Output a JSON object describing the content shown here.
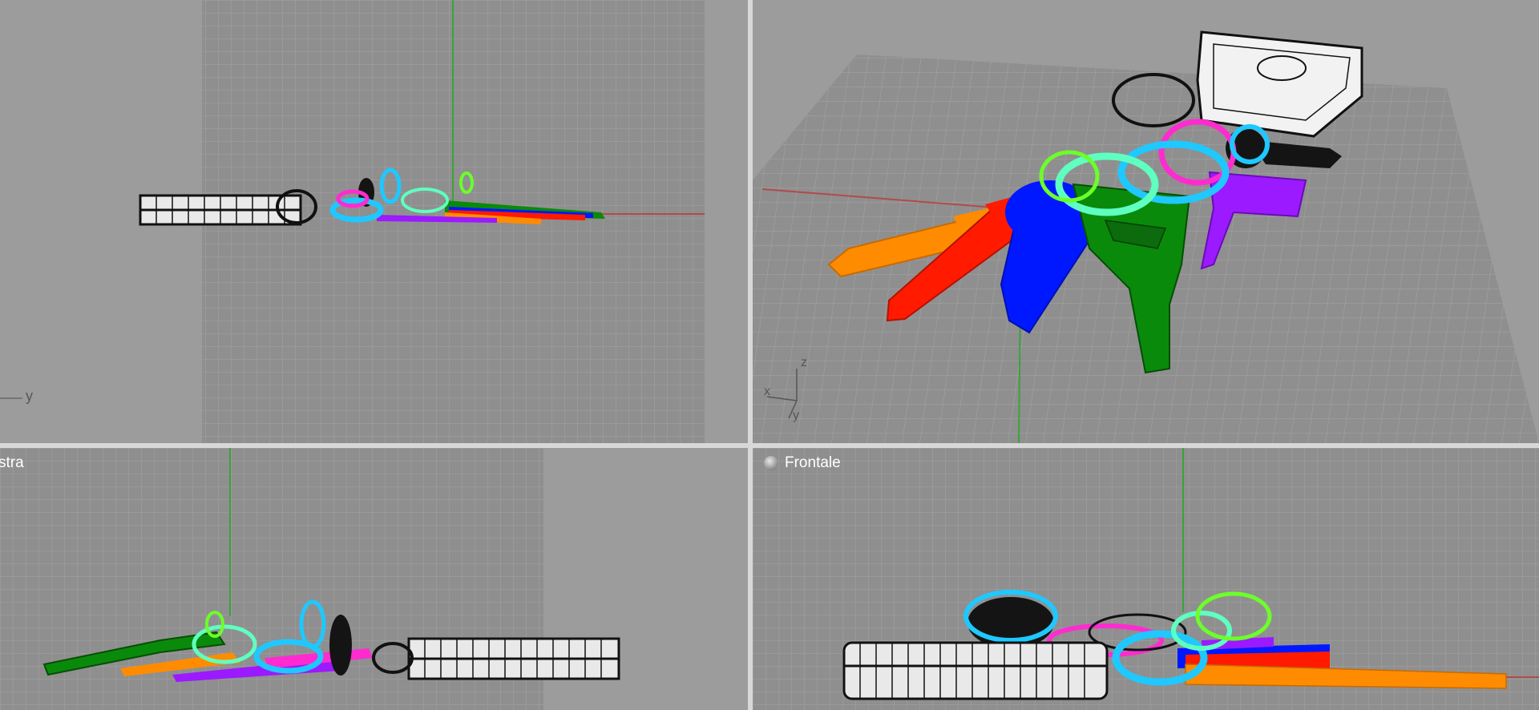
{
  "viewports": {
    "top_left": {
      "title": "",
      "axis_label": "y"
    },
    "top_right": {
      "title": "",
      "axis_x": "x",
      "axis_y": "y",
      "axis_z": "z"
    },
    "bottom_left": {
      "title": "stra"
    },
    "bottom_right": {
      "title": "Frontale"
    }
  },
  "colors": {
    "background": "#9c9c9c",
    "grid_area": "#8f8f8f",
    "axis_x": "#b34a4a",
    "axis_y": "#3aa33a",
    "key_orange": "#ff8c00",
    "key_red": "#ff1a00",
    "key_blue": "#0018ff",
    "key_green": "#0a8a0a",
    "key_purple": "#9b1aff",
    "ring_cyan": "#1fc8ff",
    "ring_magenta": "#ff2bd0",
    "ring_mint": "#5fffc0",
    "ring_lime": "#6cff2a",
    "fob_black": "#141414"
  }
}
